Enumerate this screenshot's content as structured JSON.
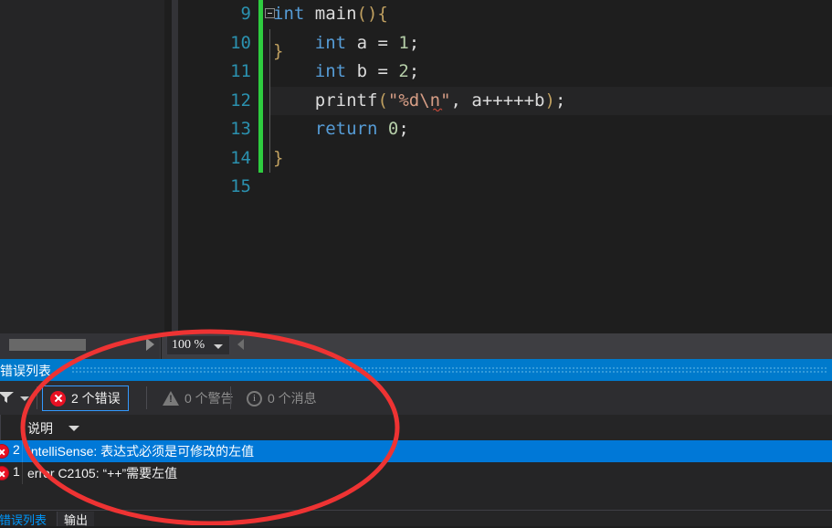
{
  "editor": {
    "zoom_level": "100 %",
    "lines": [
      {
        "num": "9",
        "indent": 0,
        "tokens": [
          {
            "t": "int",
            "c": "kw"
          },
          {
            "t": " ",
            "c": "punct"
          },
          {
            "t": "main",
            "c": "fn"
          },
          {
            "t": "(){",
            "c": "paren"
          }
        ],
        "fold": true,
        "bar": true
      },
      {
        "num": "10",
        "indent": 1,
        "tokens": [
          {
            "t": "int",
            "c": "kw"
          },
          {
            "t": " a = ",
            "c": "ident"
          },
          {
            "t": "1",
            "c": "num"
          },
          {
            "t": ";",
            "c": "punct"
          }
        ],
        "fold": false,
        "bar": true
      },
      {
        "num": "11",
        "indent": 1,
        "tokens": [
          {
            "t": "int",
            "c": "kw"
          },
          {
            "t": " b = ",
            "c": "ident"
          },
          {
            "t": "2",
            "c": "num"
          },
          {
            "t": ";",
            "c": "punct"
          }
        ],
        "fold": false,
        "bar": true
      },
      {
        "num": "12",
        "indent": 1,
        "tokens": [
          {
            "t": "printf",
            "c": "fn"
          },
          {
            "t": "(",
            "c": "paren"
          },
          {
            "t": "\"%d\\n\"",
            "c": "str"
          },
          {
            "t": ", a+++++b",
            "c": "ident"
          },
          {
            "t": ")",
            "c": "paren"
          },
          {
            "t": ";",
            "c": "punct"
          }
        ],
        "fold": false,
        "bar": true,
        "highlight": true,
        "squiggle": true
      },
      {
        "num": "13",
        "indent": 1,
        "tokens": [
          {
            "t": "return",
            "c": "kw"
          },
          {
            "t": " ",
            "c": "punct"
          },
          {
            "t": "0",
            "c": "num"
          },
          {
            "t": ";",
            "c": "punct"
          }
        ],
        "fold": false,
        "bar": true
      },
      {
        "num": "14",
        "indent": 0,
        "tokens": [
          {
            "t": "}",
            "c": "paren"
          }
        ],
        "fold": false,
        "bar": true
      },
      {
        "num": "15",
        "indent": 0,
        "tokens": [],
        "fold": false,
        "bar": false
      }
    ]
  },
  "error_list": {
    "title": "错误列表",
    "filter_icon": "funnel-icon",
    "chips": [
      {
        "icon": "error-icon",
        "label": "2 个错误",
        "selected": true
      },
      {
        "icon": "warning-icon",
        "label": "0 个警告",
        "selected": false
      },
      {
        "icon": "info-icon",
        "label": "0 个消息",
        "selected": false
      }
    ],
    "columns": [
      {
        "label": "说明",
        "sorted": true
      }
    ],
    "rows": [
      {
        "count": "2",
        "description": "IntelliSense: 表达式必须是可修改的左值",
        "severity": "error",
        "selected": true
      },
      {
        "count": "1",
        "description": "error C2105: “++”需要左值",
        "severity": "error",
        "selected": false
      }
    ]
  },
  "bottom_tabs": [
    {
      "label": "错误列表",
      "active": true
    },
    {
      "label": "输出",
      "active": false
    }
  ],
  "colors": {
    "accent_blue": "#007acc",
    "selection_blue": "#0078d7",
    "error_red": "#e81123",
    "annotation_red": "#ee3333",
    "editor_bg": "#1e1e1e",
    "panel_bg": "#252526"
  }
}
